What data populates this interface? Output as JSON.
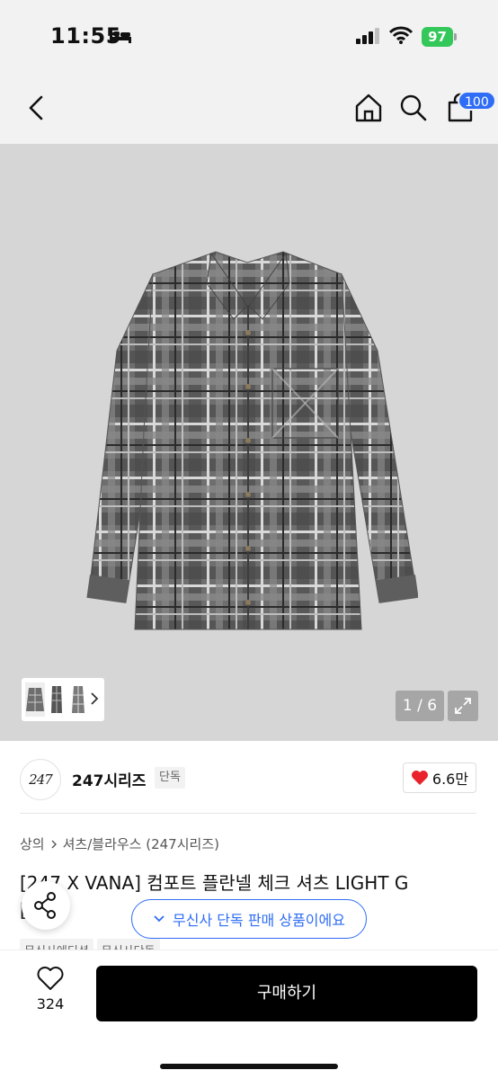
{
  "status": {
    "time": "11:55",
    "battery": "97"
  },
  "nav": {
    "cart_count": "100"
  },
  "gallery": {
    "counter": "1 / 6"
  },
  "brand": {
    "logo_text": "247",
    "name": "247시리즈",
    "badge": "단독",
    "likes": "6.6만"
  },
  "breadcrumb": {
    "level1": "상의",
    "level2": "셔츠/블라우스 (247시리즈)"
  },
  "product": {
    "title": "[247 X VANA] 컴포트 플란넬 체크 셔츠 LIGHT G",
    "title_cont": "[",
    "tags": [
      "무신사에디션",
      "무신사단독"
    ]
  },
  "exclusive_pill": "무신사 단독 판매 상품이에요",
  "bottom": {
    "wish_count": "324",
    "buy_label": "구매하기"
  },
  "colors": {
    "accent": "#2f6df6",
    "heart": "#e8232b",
    "battery": "#34c759"
  }
}
